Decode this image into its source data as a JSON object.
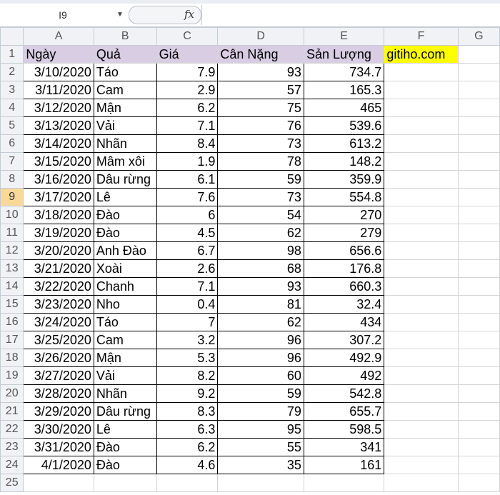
{
  "formula_bar": {
    "name_box": "I9",
    "fx": "fx",
    "formula": ""
  },
  "columns": [
    "A",
    "B",
    "C",
    "D",
    "E",
    "F",
    "G"
  ],
  "headers": [
    "Ngày",
    "Quả",
    "Giá",
    "Cân Nặng",
    "Sản Lượng"
  ],
  "extra_cell": "gitiho.com",
  "selected_row": 9,
  "rows": [
    [
      "3/10/2020",
      "Táo",
      "7.9",
      "93",
      "734.7"
    ],
    [
      "3/11/2020",
      "Cam",
      "2.9",
      "57",
      "165.3"
    ],
    [
      "3/12/2020",
      "Mận",
      "6.2",
      "75",
      "465"
    ],
    [
      "3/13/2020",
      "Vải",
      "7.1",
      "76",
      "539.6"
    ],
    [
      "3/14/2020",
      "Nhãn",
      "8.4",
      "73",
      "613.2"
    ],
    [
      "3/15/2020",
      "Mâm xôi",
      "1.9",
      "78",
      "148.2"
    ],
    [
      "3/16/2020",
      "Dâu rừng",
      "6.1",
      "59",
      "359.9"
    ],
    [
      "3/17/2020",
      "Lê",
      "7.6",
      "73",
      "554.8"
    ],
    [
      "3/18/2020",
      "Đào",
      "6",
      "54",
      "270"
    ],
    [
      "3/19/2020",
      "Đào",
      "4.5",
      "62",
      "279"
    ],
    [
      "3/20/2020",
      "Anh Đào",
      "6.7",
      "98",
      "656.6"
    ],
    [
      "3/21/2020",
      "Xoài",
      "2.6",
      "68",
      "176.8"
    ],
    [
      "3/22/2020",
      "Chanh",
      "7.1",
      "93",
      "660.3"
    ],
    [
      "3/23/2020",
      "Nho",
      "0.4",
      "81",
      "32.4"
    ],
    [
      "3/24/2020",
      "Táo",
      "7",
      "62",
      "434"
    ],
    [
      "3/25/2020",
      "Cam",
      "3.2",
      "96",
      "307.2"
    ],
    [
      "3/26/2020",
      "Mận",
      "5.3",
      "96",
      "492.9"
    ],
    [
      "3/27/2020",
      "Vải",
      "8.2",
      "60",
      "492"
    ],
    [
      "3/28/2020",
      "Nhãn",
      "9.2",
      "59",
      "542.8"
    ],
    [
      "3/29/2020",
      "Dâu rừng",
      "8.3",
      "79",
      "655.7"
    ],
    [
      "3/30/2020",
      "Lê",
      "6.3",
      "95",
      "598.5"
    ],
    [
      "3/31/2020",
      "Đào",
      "6.2",
      "55",
      "341"
    ],
    [
      "4/1/2020",
      "Đào",
      "4.6",
      "35",
      "161"
    ]
  ]
}
